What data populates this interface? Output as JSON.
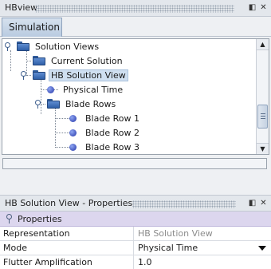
{
  "top_panel": {
    "title": "HBview",
    "tab_label": "Simulation"
  },
  "tree": {
    "items": [
      {
        "label": "Solution Views",
        "icon": "folder-icon",
        "level": 0
      },
      {
        "label": "Current Solution",
        "icon": "folder-icon",
        "level": 1
      },
      {
        "label": "HB Solution View",
        "icon": "folder-icon",
        "level": 1,
        "selected": true
      },
      {
        "label": "Physical Time",
        "icon": "dot-icon",
        "level": 2
      },
      {
        "label": "Blade Rows",
        "icon": "folder-icon",
        "level": 2
      },
      {
        "label": "Blade Row 1",
        "icon": "dot-icon",
        "level": 3
      },
      {
        "label": "Blade Row 2",
        "icon": "dot-icon",
        "level": 3
      },
      {
        "label": "Blade Row 3",
        "icon": "dot-icon",
        "level": 3
      }
    ]
  },
  "props_panel": {
    "title": "HB Solution View - Properties",
    "section_label": "Properties",
    "rows": [
      {
        "name": "Representation",
        "value": "HB Solution View"
      },
      {
        "name": "Mode",
        "value": "Physical Time"
      },
      {
        "name": "Flutter Amplification",
        "value": "1.0"
      }
    ]
  },
  "colors": {
    "selection": "#cfdff0",
    "section_header": "#dcd6ee",
    "folder": "#3f6fb8",
    "dot": "#2335a8"
  }
}
